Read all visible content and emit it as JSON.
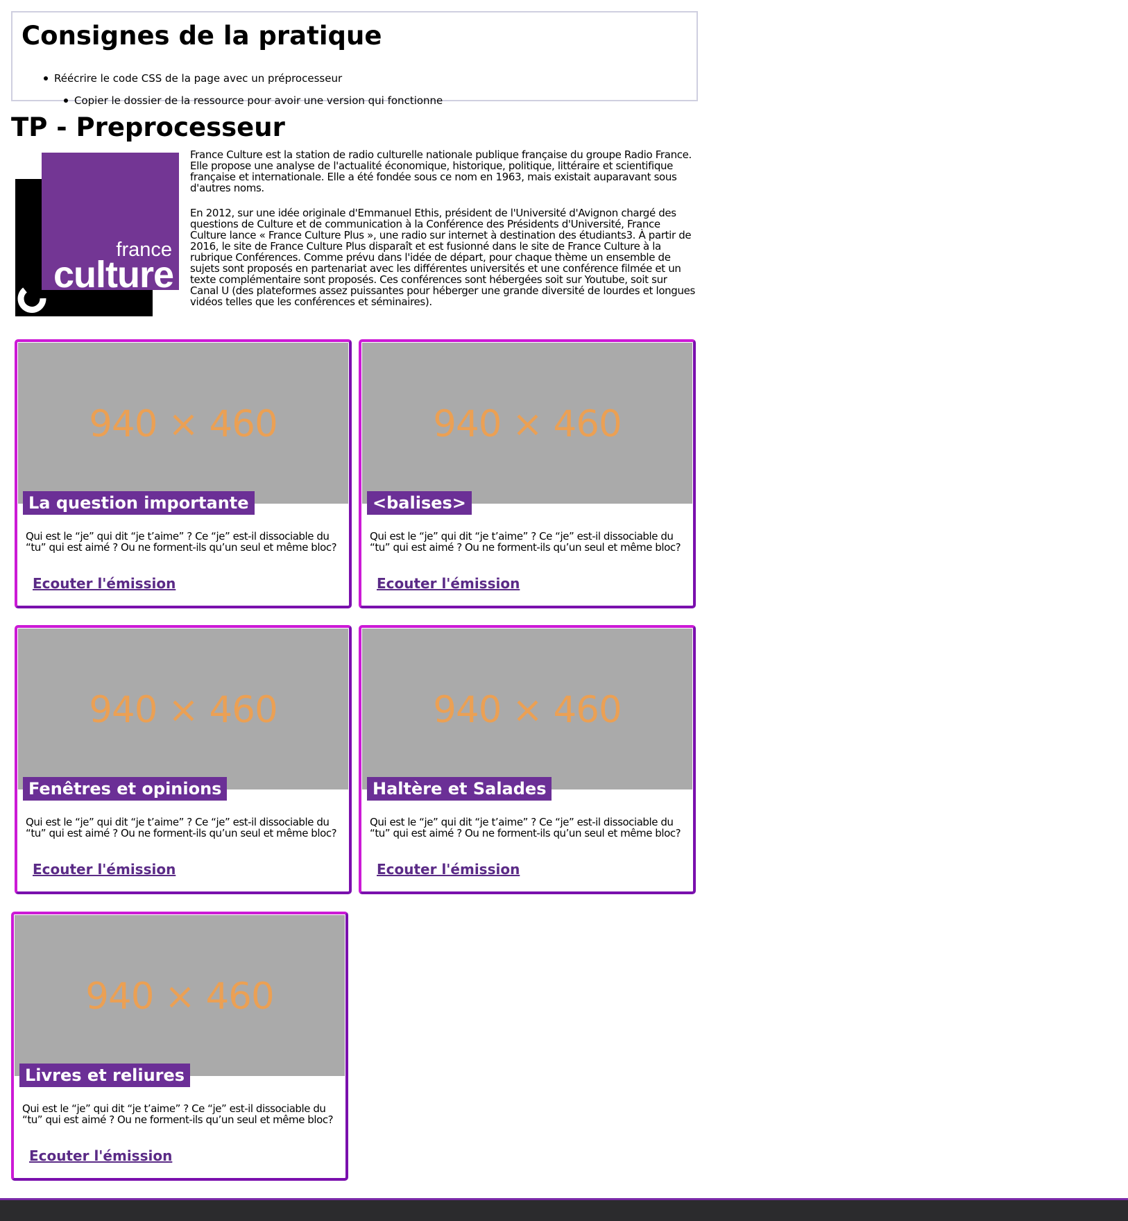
{
  "instructions": {
    "title": "Consignes de la pratique",
    "items": [
      "Réécrire le code CSS de la page avec un préprocesseur",
      "Copier le dossier de la ressource pour avoir une version qui fonctionne"
    ]
  },
  "page": {
    "title": "TP - Preprocesseur"
  },
  "logo": {
    "line1": "france",
    "line2": "culture",
    "colors": {
      "purple": "#733694",
      "black": "#000000",
      "white": "#ffffff"
    }
  },
  "intro": {
    "paragraphs": [
      "France Culture est la station de radio culturelle nationale publique française du groupe Radio France. Elle propose une analyse de l'actualité économique, historique, politique, littéraire et scientifique française et internationale. Elle a été fondée sous ce nom en 1963, mais existait auparavant sous d'autres noms.",
      "En 2012, sur une idée originale d'Emmanuel Ethis, président de l'Université d'Avignon chargé des questions de Culture et de communication à la Conférence des Présidents d'Université, France Culture lance « France Culture Plus », une radio sur internet à destination des étudiants3. À partir de 2016, le site de France Culture Plus disparaît et est fusionné dans le site de France Culture à la rubrique Conférences. Comme prévu dans l'idée de départ, pour chaque thème un ensemble de sujets sont proposés en partenariat avec les différentes universités et une conférence filmée et un texte complémentaire sont proposés. Ces conférences sont hébergées soit sur Youtube, soit sur Canal U (des plateformes assez puissantes pour héberger une grande diversité de lourdes et longues vidéos telles que les conférences et séminaires)."
    ]
  },
  "cards": [
    {
      "image_label": "940 × 460",
      "title": "La question importante",
      "text": "Qui est le “je” qui dit “je t’aime” ? Ce “je” est-il dissociable du “tu” qui est aimé ? Ou ne forment-ils qu’un seul et même bloc?",
      "link": "Ecouter l'émission"
    },
    {
      "image_label": "940 × 460",
      "title": "<balises>",
      "text": "Qui est le “je” qui dit “je t’aime” ? Ce “je” est-il dissociable du “tu” qui est aimé ? Ou ne forment-ils qu’un seul et même bloc?",
      "link": "Ecouter l'émission"
    },
    {
      "image_label": "940 × 460",
      "title": "Fenêtres et opinions",
      "text": "Qui est le “je” qui dit “je t’aime” ? Ce “je” est-il dissociable du “tu” qui est aimé ? Ou ne forment-ils qu’un seul et même bloc?",
      "link": "Ecouter l'émission"
    },
    {
      "image_label": "940 × 460",
      "title": "Haltère et Salades",
      "text": "Qui est le “je” qui dit “je t’aime” ? Ce “je” est-il dissociable du “tu” qui est aimé ? Ou ne forment-ils qu’un seul et même bloc?",
      "link": "Ecouter l'émission"
    },
    {
      "image_label": "940 × 460",
      "title": "Livres et reliures",
      "text": "Qui est le “je” qui dit “je t’aime” ? Ce “je” est-il dissociable du “tu” qui est aimé ? Ou ne forment-ils qu’un seul et même bloc?",
      "link": "Ecouter l'émission"
    }
  ],
  "colors": {
    "accent": "#6b2f96",
    "card_border_light": "#cc1ad6",
    "card_border_dark": "#7a10ad",
    "placeholder_bg": "#aaaaaa",
    "placeholder_text": "#eba054",
    "footer": "#2b2b2d"
  }
}
